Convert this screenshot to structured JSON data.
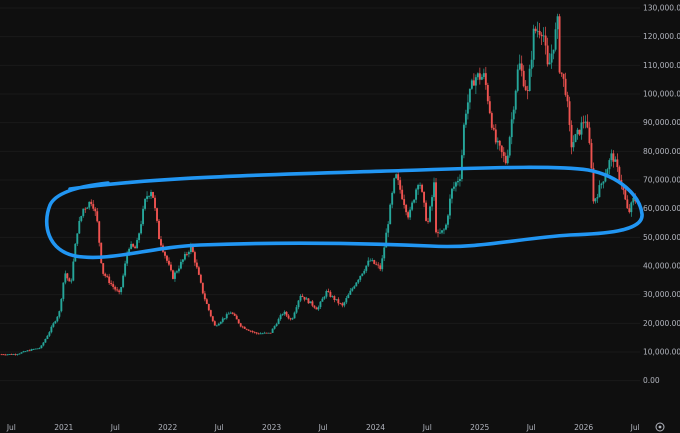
{
  "colors": {
    "background": "#0f0f0f",
    "up": "#26a69a",
    "down": "#ef5350",
    "annotation": "#2196f3",
    "axis_text": "#b2b5be"
  },
  "chart_data": {
    "type": "candlestick",
    "title": "",
    "xlabel": "",
    "ylabel": "",
    "ylim": [
      -5000,
      130000
    ],
    "xlim": [
      "2020-05-22",
      "2026-07-18"
    ],
    "y_ticks": [
      {
        "value": 0,
        "label": "0.00"
      },
      {
        "value": 10000,
        "label": "10,000.00"
      },
      {
        "value": 20000,
        "label": "20,000.00"
      },
      {
        "value": 30000,
        "label": "30,000.00"
      },
      {
        "value": 40000,
        "label": "40,000.00"
      },
      {
        "value": 50000,
        "label": "50,000.00"
      },
      {
        "value": 60000,
        "label": "60,000.00"
      },
      {
        "value": 70000,
        "label": "70,000.00"
      },
      {
        "value": 80000,
        "label": "80,000.00"
      },
      {
        "value": 90000,
        "label": "90,000.00"
      },
      {
        "value": 100000,
        "label": "100,000.00"
      },
      {
        "value": 110000,
        "label": "110,000.00"
      },
      {
        "value": 120000,
        "label": "120,000.00"
      },
      {
        "value": 130000,
        "label": "130,000.00"
      }
    ],
    "x_ticks": [
      {
        "date": "2020-07-01",
        "label": "Jul"
      },
      {
        "date": "2021-01-01",
        "label": "2021"
      },
      {
        "date": "2021-07-01",
        "label": "Jul"
      },
      {
        "date": "2022-01-01",
        "label": "2022"
      },
      {
        "date": "2022-07-01",
        "label": "Jul"
      },
      {
        "date": "2023-01-01",
        "label": "2023"
      },
      {
        "date": "2023-07-01",
        "label": "Jul"
      },
      {
        "date": "2024-01-01",
        "label": "2024"
      },
      {
        "date": "2024-07-01",
        "label": "Jul"
      },
      {
        "date": "2025-01-01",
        "label": "2025"
      },
      {
        "date": "2025-07-01",
        "label": "Jul"
      },
      {
        "date": "2026-01-01",
        "label": "2026"
      },
      {
        "date": "2026-07-01",
        "label": "Jul"
      }
    ],
    "price_path": [
      [
        "2020-05-24",
        9200
      ],
      [
        "2020-07-20",
        9200
      ],
      [
        "2020-09-01",
        10500
      ],
      [
        "2020-10-15",
        11500
      ],
      [
        "2020-11-20",
        18000
      ],
      [
        "2020-12-20",
        24000
      ],
      [
        "2021-01-08",
        38000
      ],
      [
        "2021-01-28",
        33000
      ],
      [
        "2021-02-20",
        52000
      ],
      [
        "2021-03-14",
        60000
      ],
      [
        "2021-04-14",
        63000
      ],
      [
        "2021-05-01",
        56000
      ],
      [
        "2021-05-20",
        38000
      ],
      [
        "2021-06-25",
        33000
      ],
      [
        "2021-07-20",
        30000
      ],
      [
        "2021-08-20",
        47000
      ],
      [
        "2021-09-15",
        46000
      ],
      [
        "2021-10-20",
        64000
      ],
      [
        "2021-11-10",
        67000
      ],
      [
        "2021-12-05",
        50000
      ],
      [
        "2022-01-22",
        36000
      ],
      [
        "2022-03-28",
        47000
      ],
      [
        "2022-05-10",
        30000
      ],
      [
        "2022-06-18",
        19000
      ],
      [
        "2022-08-15",
        24000
      ],
      [
        "2022-09-20",
        19000
      ],
      [
        "2022-11-10",
        16500
      ],
      [
        "2022-12-30",
        16500
      ],
      [
        "2023-02-15",
        24000
      ],
      [
        "2023-03-15",
        21000
      ],
      [
        "2023-04-15",
        30000
      ],
      [
        "2023-06-15",
        25000
      ],
      [
        "2023-07-15",
        31000
      ],
      [
        "2023-09-10",
        26000
      ],
      [
        "2023-10-25",
        34000
      ],
      [
        "2023-12-15",
        42000
      ],
      [
        "2024-01-23",
        39000
      ],
      [
        "2024-02-28",
        62000
      ],
      [
        "2024-03-14",
        72000
      ],
      [
        "2024-05-01",
        57000
      ],
      [
        "2024-06-05",
        71000
      ],
      [
        "2024-07-05",
        54000
      ],
      [
        "2024-07-29",
        69000
      ],
      [
        "2024-08-05",
        50000
      ],
      [
        "2024-09-06",
        53000
      ],
      [
        "2024-09-27",
        66000
      ],
      [
        "2024-10-29",
        72000
      ],
      [
        "2024-11-13",
        93000
      ],
      [
        "2024-12-17",
        106000
      ],
      [
        "2025-01-21",
        106000
      ],
      [
        "2025-02-26",
        84000
      ],
      [
        "2025-04-08",
        76000
      ],
      [
        "2025-05-22",
        111000
      ],
      [
        "2025-06-22",
        100000
      ],
      [
        "2025-07-14",
        122000
      ],
      [
        "2025-08-14",
        123000
      ],
      [
        "2025-09-01",
        108000
      ],
      [
        "2025-10-06",
        125000
      ],
      [
        "2025-10-11",
        110000
      ],
      [
        "2025-11-04",
        101000
      ],
      [
        "2025-11-21",
        82000
      ],
      [
        "2025-12-15",
        86000
      ],
      [
        "2026-01-10",
        92000
      ],
      [
        "2026-01-31",
        78000
      ],
      [
        "2026-02-06",
        62000
      ],
      [
        "2026-03-01",
        67000
      ],
      [
        "2026-04-15",
        79000
      ],
      [
        "2026-05-20",
        68000
      ],
      [
        "2026-06-10",
        58000
      ],
      [
        "2026-06-28",
        63000
      ]
    ],
    "annotations": [
      {
        "type": "hand-drawn-ellipse",
        "color": "#2196f3",
        "from": "2021-01",
        "to": "2026-07",
        "y_range": [
          45000,
          76000
        ]
      }
    ],
    "grid": false,
    "y_axis_side": "right"
  }
}
